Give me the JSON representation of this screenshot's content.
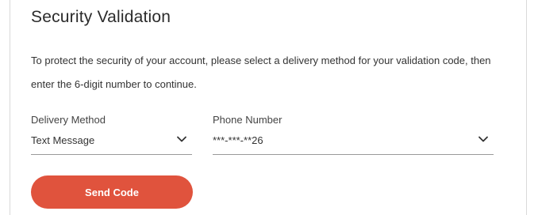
{
  "page": {
    "title": "Security Validation",
    "description": "To protect the security of your account, please select a delivery method for your validation code, then enter the 6-digit number to continue."
  },
  "form": {
    "delivery_method": {
      "label": "Delivery Method",
      "value": "Text Message",
      "icon": "chevron-down-icon"
    },
    "phone_number": {
      "label": "Phone Number",
      "value": "***-***-**26",
      "icon": "chevron-down-icon"
    },
    "send_button": {
      "label": "Send Code",
      "color": "#e0533d"
    }
  }
}
